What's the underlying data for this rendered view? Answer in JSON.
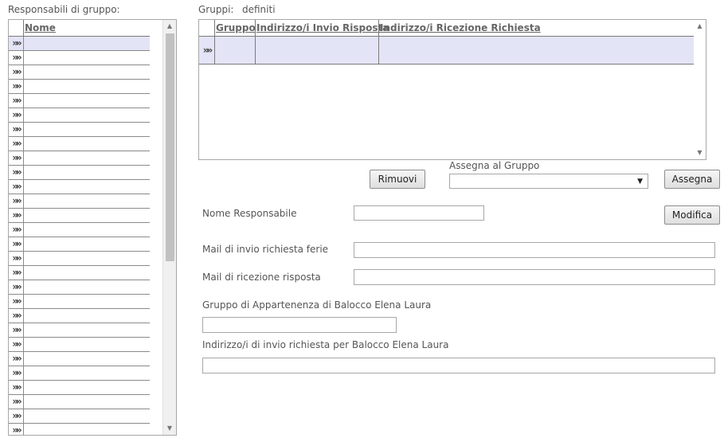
{
  "left": {
    "title": "Responsabili di gruppo:",
    "column": "Nome",
    "row_count": 28,
    "row_marker": "»»"
  },
  "groups": {
    "title": "Gruppi:",
    "subtitle": "definiti",
    "columns": [
      "Gruppo",
      "Indirizzo/i Invio Risposta",
      "Indirizzo/i Ricezione Richiesta"
    ],
    "row_marker": "»»"
  },
  "actions": {
    "remove_label": "Rimuovi",
    "assign_group_label": "Assegna al Gruppo",
    "assign_group_value": "",
    "assign_label": "Assegna",
    "modify_label": "Modifica"
  },
  "form": {
    "responsible_name_label": "Nome Responsabile",
    "responsible_name_value": "",
    "mail_send_label": "Mail di invio richiesta ferie",
    "mail_send_value": "",
    "mail_receive_label": "Mail di ricezione risposta",
    "mail_receive_value": "",
    "group_membership_label": "Gruppo di Appartenenza di Balocco Elena Laura",
    "group_membership_value": "",
    "send_addresses_label": "Indirizzo/i di invio richiesta per Balocco Elena Laura",
    "send_addresses_value": ""
  }
}
